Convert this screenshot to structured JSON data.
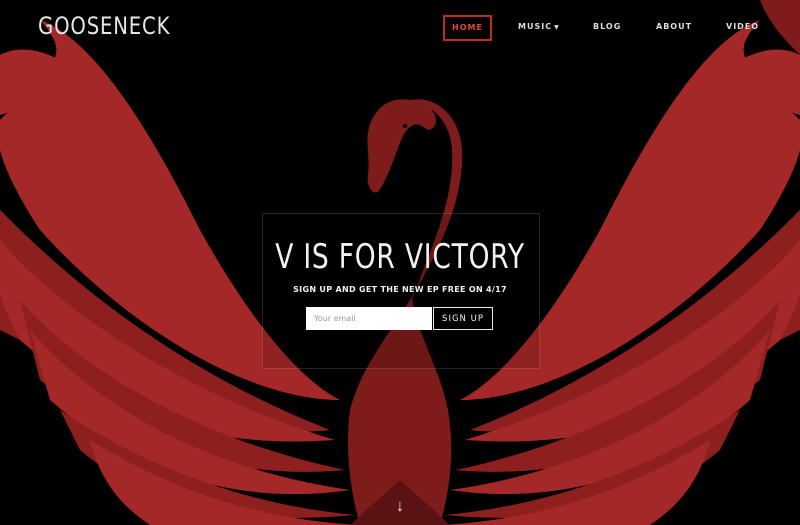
{
  "header": {
    "brand": "GOOSENECK"
  },
  "nav": {
    "items": [
      {
        "label": "HOME",
        "active": true
      },
      {
        "label": "MUSIC",
        "dropdown": true
      },
      {
        "label": "BLOG"
      },
      {
        "label": "ABOUT"
      },
      {
        "label": "VIDEO"
      }
    ]
  },
  "hero": {
    "title": "V IS FOR VICTORY",
    "subtitle": "SIGN UP AND GET THE NEW EP FREE ON 4/17",
    "email_placeholder": "Your email",
    "signup_label": "SIGN UP",
    "scroll_icon": "arrow-down-icon"
  },
  "colors": {
    "background": "#000000",
    "swan_red": "#a42827",
    "swan_dark": "#7e1b1b",
    "accent": "#e8443e"
  }
}
